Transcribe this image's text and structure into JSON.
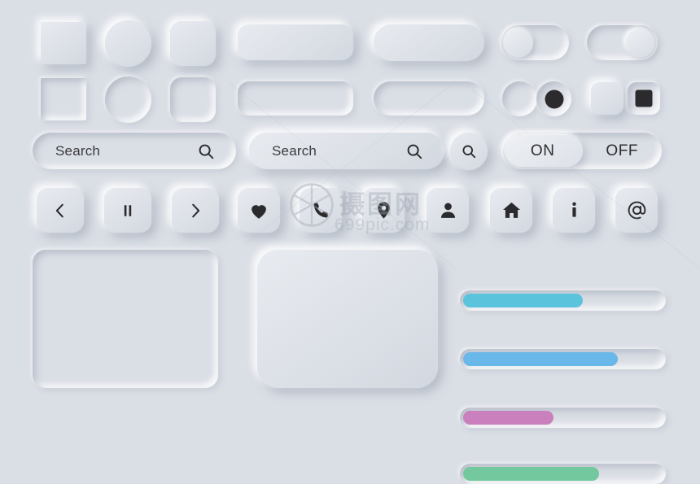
{
  "meta": {
    "title": "Neumorphic UI Elements Kit",
    "background_color": "#dadee5",
    "icon_color": "#2b2b2d",
    "surface_light": "#eef0f4",
    "surface_dark": "#d3d8e0"
  },
  "shapes_row_raised": [
    {
      "name": "square",
      "style": "raised"
    },
    {
      "name": "circle",
      "style": "raised"
    },
    {
      "name": "rounded-square",
      "style": "raised"
    },
    {
      "name": "rounded-rectangle-button",
      "style": "raised"
    },
    {
      "name": "pill-button",
      "style": "raised"
    }
  ],
  "shapes_row_inset": [
    {
      "name": "square",
      "style": "inset"
    },
    {
      "name": "circle",
      "style": "inset"
    },
    {
      "name": "rounded-square",
      "style": "inset"
    },
    {
      "name": "rounded-rectangle-button",
      "style": "inset"
    },
    {
      "name": "pill-button",
      "style": "inset"
    }
  ],
  "toggles": [
    {
      "name": "toggle-switch-off",
      "state": "off",
      "knob_position": "left"
    },
    {
      "name": "toggle-switch-on",
      "state": "on",
      "knob_position": "right"
    }
  ],
  "selectors": [
    {
      "name": "radio-unchecked",
      "type": "radio",
      "checked": false
    },
    {
      "name": "radio-checked",
      "type": "radio",
      "checked": true
    },
    {
      "name": "checkbox-unchecked",
      "type": "checkbox",
      "checked": false
    },
    {
      "name": "checkbox-checked",
      "type": "checkbox",
      "checked": true
    }
  ],
  "search": {
    "inset_field": {
      "value": "Search",
      "placeholder": "Search",
      "icon": "search-icon",
      "style": "inset"
    },
    "raised_field": {
      "value": "Search",
      "placeholder": "Search",
      "icon": "search-icon",
      "style": "raised"
    },
    "round_button": {
      "icon": "search-icon",
      "style": "raised"
    }
  },
  "onoff": {
    "on_label": "ON",
    "off_label": "OFF",
    "selected": "ON"
  },
  "icon_buttons": [
    {
      "name": "previous-icon",
      "label": "Previous"
    },
    {
      "name": "pause-icon",
      "label": "Pause"
    },
    {
      "name": "next-icon",
      "label": "Next"
    },
    {
      "name": "heart-icon",
      "label": "Favorite"
    },
    {
      "name": "phone-icon",
      "label": "Call"
    },
    {
      "name": "location-pin-icon",
      "label": "Location"
    },
    {
      "name": "person-icon",
      "label": "Profile"
    },
    {
      "name": "home-icon",
      "label": "Home"
    },
    {
      "name": "info-icon",
      "label": "Info"
    },
    {
      "name": "at-sign-icon",
      "label": "Email"
    }
  ],
  "panels": [
    {
      "name": "panel-inset",
      "style": "inset"
    },
    {
      "name": "panel-raised",
      "style": "raised"
    }
  ],
  "progress_bars": [
    {
      "name": "progress-bar-teal",
      "color": "#5cc3dc",
      "percent": 60
    },
    {
      "name": "progress-bar-blue",
      "color": "#6ab7ea",
      "percent": 77
    },
    {
      "name": "progress-bar-pink",
      "color": "#c980bd",
      "percent": 46
    },
    {
      "name": "progress-bar-green",
      "color": "#73c89e",
      "percent": 68
    }
  ],
  "watermark": {
    "text": "摄图网",
    "subtext": "699pic.com",
    "logo": "camera-aperture-icon"
  }
}
